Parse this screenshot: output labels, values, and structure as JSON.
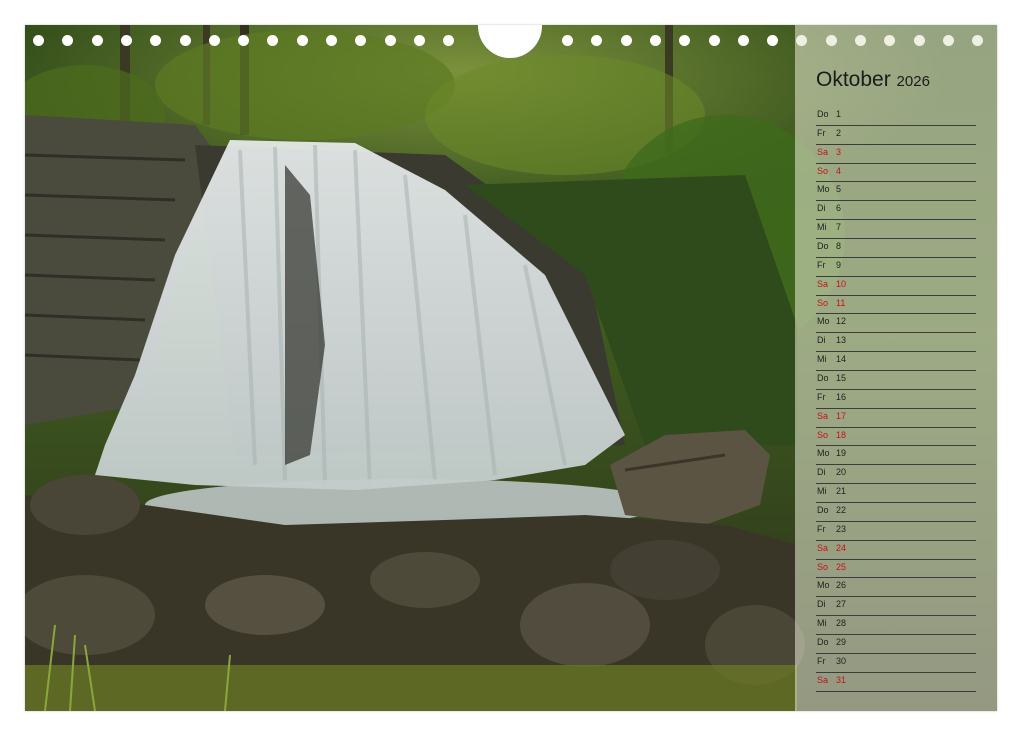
{
  "calendar": {
    "month": "Oktober",
    "year": "2026",
    "colors": {
      "weekend": "#c5121b",
      "text": "#222222"
    },
    "days": [
      {
        "weekday": "Do",
        "day": "1",
        "weekend": false
      },
      {
        "weekday": "Fr",
        "day": "2",
        "weekend": false
      },
      {
        "weekday": "Sa",
        "day": "3",
        "weekend": true
      },
      {
        "weekday": "So",
        "day": "4",
        "weekend": true
      },
      {
        "weekday": "Mo",
        "day": "5",
        "weekend": false
      },
      {
        "weekday": "Di",
        "day": "6",
        "weekend": false
      },
      {
        "weekday": "Mi",
        "day": "7",
        "weekend": false
      },
      {
        "weekday": "Do",
        "day": "8",
        "weekend": false
      },
      {
        "weekday": "Fr",
        "day": "9",
        "weekend": false
      },
      {
        "weekday": "Sa",
        "day": "10",
        "weekend": true
      },
      {
        "weekday": "So",
        "day": "11",
        "weekend": true
      },
      {
        "weekday": "Mo",
        "day": "12",
        "weekend": false
      },
      {
        "weekday": "Di",
        "day": "13",
        "weekend": false
      },
      {
        "weekday": "Mi",
        "day": "14",
        "weekend": false
      },
      {
        "weekday": "Do",
        "day": "15",
        "weekend": false
      },
      {
        "weekday": "Fr",
        "day": "16",
        "weekend": false
      },
      {
        "weekday": "Sa",
        "day": "17",
        "weekend": true
      },
      {
        "weekday": "So",
        "day": "18",
        "weekend": true
      },
      {
        "weekday": "Mo",
        "day": "19",
        "weekend": false
      },
      {
        "weekday": "Di",
        "day": "20",
        "weekend": false
      },
      {
        "weekday": "Mi",
        "day": "21",
        "weekend": false
      },
      {
        "weekday": "Do",
        "day": "22",
        "weekend": false
      },
      {
        "weekday": "Fr",
        "day": "23",
        "weekend": false
      },
      {
        "weekday": "Sa",
        "day": "24",
        "weekend": true
      },
      {
        "weekday": "So",
        "day": "25",
        "weekend": true
      },
      {
        "weekday": "Mo",
        "day": "26",
        "weekend": false
      },
      {
        "weekday": "Di",
        "day": "27",
        "weekend": false
      },
      {
        "weekday": "Mi",
        "day": "28",
        "weekend": false
      },
      {
        "weekday": "Do",
        "day": "29",
        "weekend": false
      },
      {
        "weekday": "Fr",
        "day": "30",
        "weekend": false
      },
      {
        "weekday": "Sa",
        "day": "31",
        "weekend": true
      }
    ]
  }
}
